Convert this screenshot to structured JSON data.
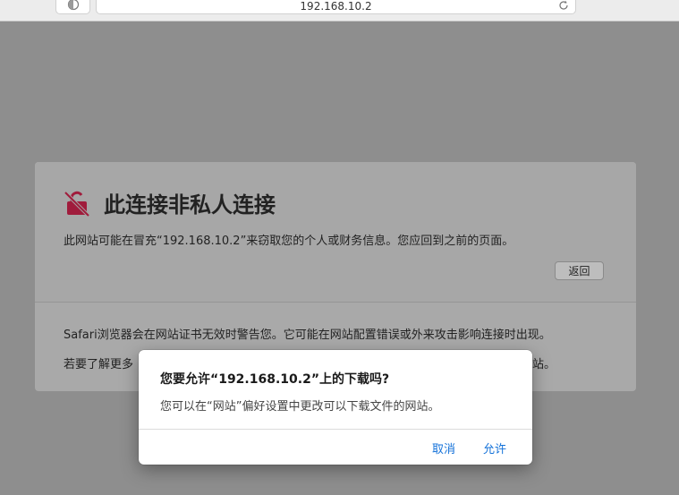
{
  "toolbar": {
    "address": "192.168.10.2"
  },
  "warning": {
    "title": "此连接非私人连接",
    "description": "此网站可能在冒充“192.168.10.2”来窃取您的个人或财务信息。您应回到之前的页面。",
    "back_label": "返回",
    "detail_line1": "Safari浏览器会在网站证书无效时警告您。它可能在网站配置错误或外来攻击影响连接时出现。",
    "detail_line2_head": "若要了解更多",
    "detail_line2_tail": "站。"
  },
  "dialog": {
    "title": "您要允许“192.168.10.2”上的下载吗?",
    "message": "您可以在“网站”偏好设置中更改可以下载文件的网站。",
    "cancel_label": "取消",
    "allow_label": "允许"
  },
  "colors": {
    "accent": "#1472d9",
    "warning_icon": "#a01c3c"
  }
}
